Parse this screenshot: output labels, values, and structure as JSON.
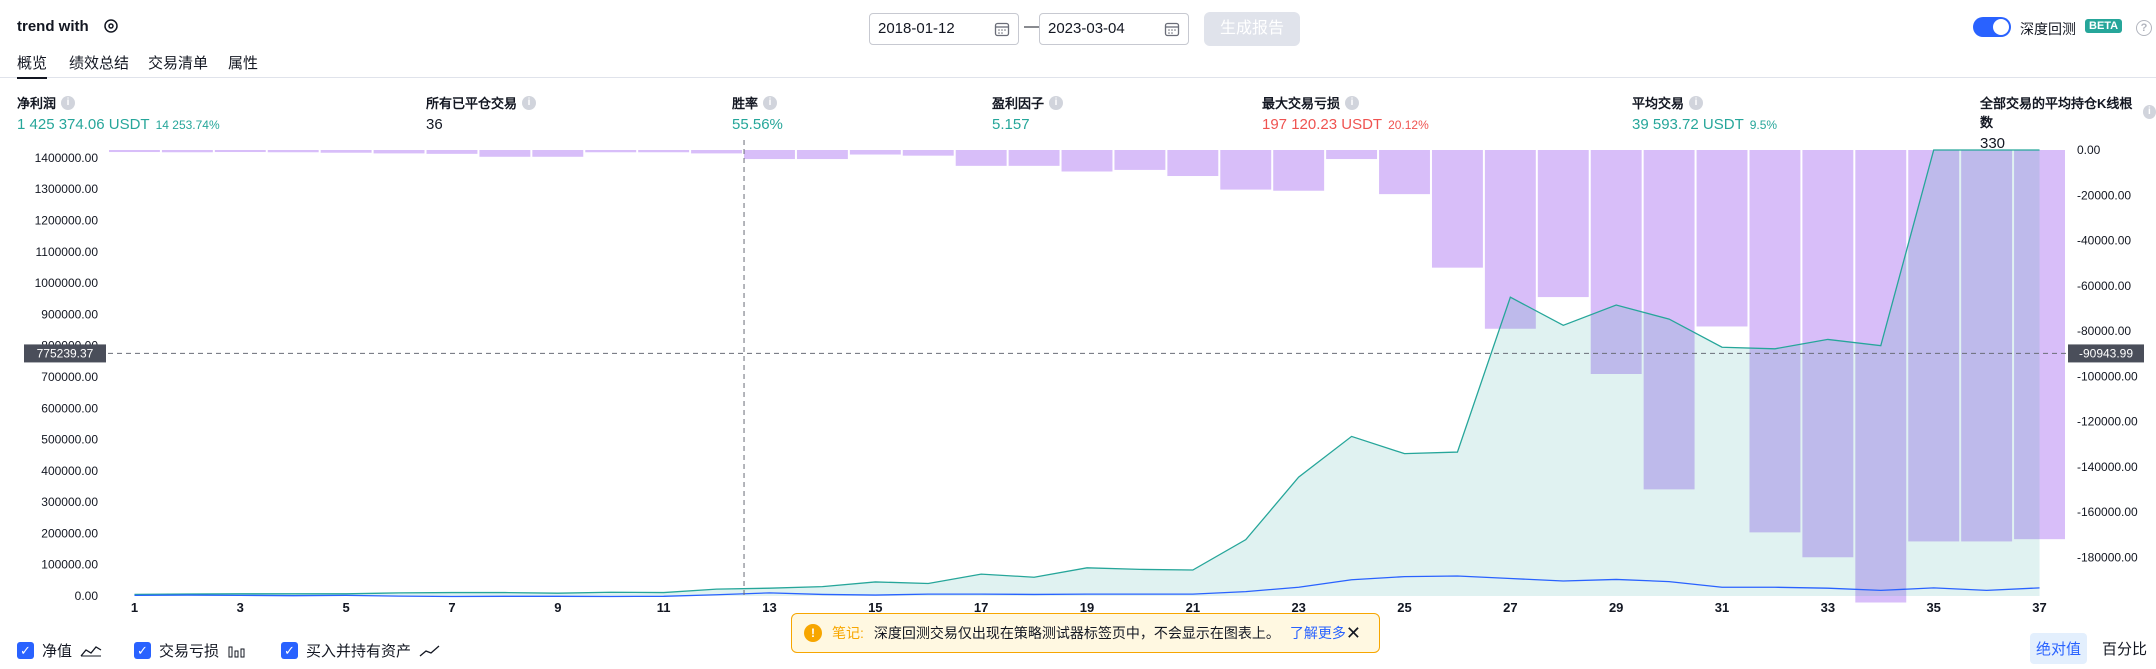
{
  "header": {
    "title": "trend with",
    "date_from": "2018-01-12",
    "date_to": "2023-03-04",
    "date_separator": "—",
    "generate_label": "生成报告",
    "deep_backtest_label": "深度回测",
    "beta_label": "BETA",
    "help_label": "?"
  },
  "tabs": [
    {
      "label": "概览",
      "active": true
    },
    {
      "label": "绩效总结",
      "active": false
    },
    {
      "label": "交易清单",
      "active": false
    },
    {
      "label": "属性",
      "active": false
    }
  ],
  "metrics": [
    {
      "label": "净利润",
      "value": "1 425 374.06 USDT",
      "pct": "14 253.74%",
      "tone": "green"
    },
    {
      "label": "所有已平仓交易",
      "value": "36",
      "pct": "",
      "tone": ""
    },
    {
      "label": "胜率",
      "value": "55.56%",
      "pct": "",
      "tone": "green"
    },
    {
      "label": "盈利因子",
      "value": "5.157",
      "pct": "",
      "tone": "green"
    },
    {
      "label": "最大交易亏损",
      "value": "197 120.23 USDT",
      "pct": "20.12%",
      "tone": "red"
    },
    {
      "label": "平均交易",
      "value": "39 593.72 USDT",
      "pct": "9.5%",
      "tone": "green"
    },
    {
      "label": "全部交易的平均持仓K线根数",
      "value": "330",
      "pct": "",
      "tone": ""
    }
  ],
  "chart_data": {
    "type": "area",
    "left_axis": {
      "ticks": [
        "1400000.00",
        "1300000.00",
        "1200000.00",
        "1100000.00",
        "1000000.00",
        "900000.00",
        "800000.00",
        "700000.00",
        "600000.00",
        "500000.00",
        "400000.00",
        "300000.00",
        "200000.00",
        "100000.00",
        "0.00"
      ],
      "ylim": [
        0,
        1425374
      ]
    },
    "right_axis": {
      "ticks": [
        "0.00",
        "-20000.00",
        "-40000.00",
        "-60000.00",
        "-80000.00",
        "-100000.00",
        "-120000.00",
        "-140000.00",
        "-160000.00",
        "-180000.00"
      ],
      "ylim": [
        -197120,
        0
      ]
    },
    "x_ticks": [
      "1",
      "3",
      "5",
      "7",
      "9",
      "11",
      "13",
      "15",
      "17",
      "19",
      "21",
      "23",
      "25",
      "27",
      "29",
      "31",
      "33",
      "35",
      "37"
    ],
    "crosshair": {
      "left_label": "775239.37",
      "right_label": "-90943.99",
      "x_index": 13
    },
    "series": [
      {
        "name": "净值",
        "color": "#26a69a",
        "x": [
          1,
          2,
          3,
          4,
          5,
          6,
          7,
          8,
          9,
          10,
          11,
          12,
          13,
          14,
          15,
          16,
          17,
          18,
          19,
          20,
          21,
          22,
          23,
          24,
          25,
          26,
          27,
          28,
          29,
          30,
          31,
          32,
          33,
          34,
          35,
          36,
          37
        ],
        "values": [
          5000,
          6500,
          7000,
          7000,
          7000,
          10000,
          11000,
          11000,
          9000,
          12000,
          11000,
          22000,
          25000,
          30000,
          45000,
          40000,
          70000,
          60000,
          90000,
          85000,
          83000,
          180000,
          380000,
          510000,
          455000,
          460000,
          955000,
          865000,
          930000,
          885000,
          795000,
          790000,
          820000,
          800000,
          1425374,
          1425374,
          1425374
        ]
      },
      {
        "name": "买入并持有资产",
        "color": "#2962ff",
        "x": [
          1,
          2,
          3,
          4,
          5,
          6,
          7,
          8,
          9,
          10,
          11,
          12,
          13,
          14,
          15,
          16,
          17,
          18,
          19,
          20,
          21,
          22,
          23,
          24,
          25,
          26,
          27,
          28,
          29,
          30,
          31,
          32,
          33,
          34,
          35,
          36,
          37
        ],
        "values": [
          2000,
          3000,
          2000,
          1000,
          2000,
          -500,
          -1500,
          -1000,
          -1000,
          -1500,
          -1000,
          4000,
          10000,
          5000,
          3000,
          6000,
          6000,
          5000,
          6000,
          6000,
          6000,
          14000,
          28000,
          52000,
          62000,
          64000,
          56000,
          48000,
          53000,
          46000,
          28000,
          28000,
          25000,
          18000,
          26000,
          18000,
          26000
        ]
      },
      {
        "name": "交易亏损",
        "color": "#d1b3f8",
        "x": [
          1,
          2,
          3,
          4,
          5,
          6,
          7,
          8,
          9,
          10,
          11,
          12,
          13,
          14,
          15,
          16,
          17,
          18,
          19,
          20,
          21,
          22,
          23,
          24,
          25,
          26,
          27,
          28,
          29,
          30,
          31,
          32,
          33,
          34,
          35,
          36,
          37
        ],
        "values": [
          -900,
          -1000,
          -900,
          -1000,
          -1200,
          -1500,
          -1700,
          -3000,
          -3000,
          -1000,
          -1000,
          -1500,
          -4000,
          -4000,
          -2000,
          -2500,
          -7000,
          -7000,
          -9500,
          -8800,
          -11500,
          -17500,
          -18000,
          -4000,
          -19500,
          -52000,
          -79000,
          -65000,
          -99000,
          -150000,
          -78000,
          -169000,
          -180000,
          -200000,
          -173000,
          -173000,
          -172000
        ]
      }
    ]
  },
  "footer": {
    "legend": [
      {
        "label": "净值",
        "icon": "area-chart-icon"
      },
      {
        "label": "交易亏损",
        "icon": "bar-chart-icon"
      },
      {
        "label": "买入并持有资产",
        "icon": "line-chart-icon"
      }
    ],
    "notice_title": "笔记:",
    "notice_text": "深度回测交易仅出现在策略测试器标签页中，不会显示在图表上。",
    "notice_link": "了解更多",
    "seg_abs": "绝对值",
    "seg_pct": "百分比"
  }
}
